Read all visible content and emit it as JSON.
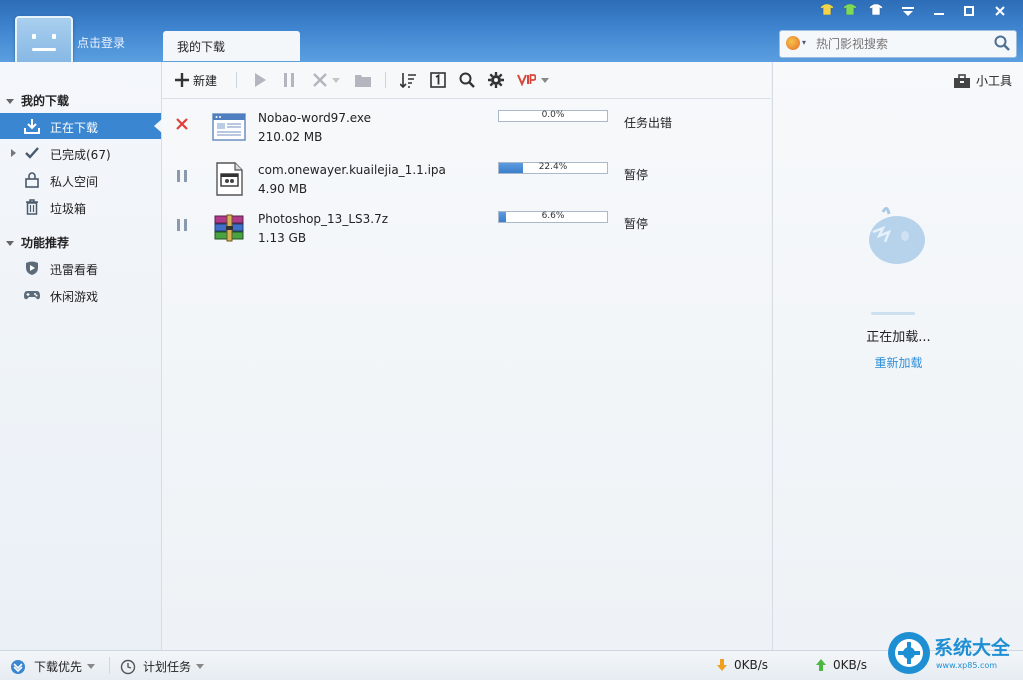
{
  "header": {
    "login_label": "点击登录",
    "tab_label": "我的下载",
    "search_placeholder": "热门影视搜索",
    "window_controls": [
      "skin-icon",
      "skin-icon",
      "skin-icon",
      "menu-icon",
      "minimize-icon",
      "maximize-icon",
      "close-icon"
    ]
  },
  "sidebar": {
    "section_downloads": "我的下载",
    "items": [
      {
        "label": "正在下载",
        "icon": "download-icon",
        "active": true
      },
      {
        "label": "已完成(67)",
        "icon": "check-icon"
      },
      {
        "label": "私人空间",
        "icon": "lock-icon"
      },
      {
        "label": "垃圾箱",
        "icon": "trash-icon"
      }
    ],
    "section_features": "功能推荐",
    "features": [
      {
        "label": "迅雷看看",
        "icon": "play-shield-icon"
      },
      {
        "label": "休闲游戏",
        "icon": "gamepad-icon"
      }
    ]
  },
  "toolbar": {
    "new_label": "新建",
    "tools_label": "小工具",
    "accent": "#3a86d1"
  },
  "downloads": [
    {
      "name": "Nobao-word97.exe",
      "size": "210.02 MB",
      "progress": 0.0,
      "progress_text": "0.0%",
      "status": "任务出错",
      "action": "delete-icon",
      "type": "exe"
    },
    {
      "name": "com.onewayer.kuailejia_1.1.ipa",
      "size": "4.90 MB",
      "progress": 22.4,
      "progress_text": "22.4%",
      "status": "暂停",
      "action": "pause-icon",
      "type": "ipa"
    },
    {
      "name": "Photoshop_13_LS3.7z",
      "size": "1.13 GB",
      "progress": 6.6,
      "progress_text": "6.6%",
      "status": "暂停",
      "action": "pause-icon",
      "type": "7z"
    }
  ],
  "right_panel": {
    "loading_text": "正在加载...",
    "reload_link": "重新加载"
  },
  "statusbar": {
    "priority_label": "下载优先",
    "schedule_label": "计划任务",
    "down_speed": "0KB/s",
    "up_speed": "0KB/s"
  },
  "watermark": {
    "brand": "系统大全",
    "url": "www.xp85.com"
  }
}
